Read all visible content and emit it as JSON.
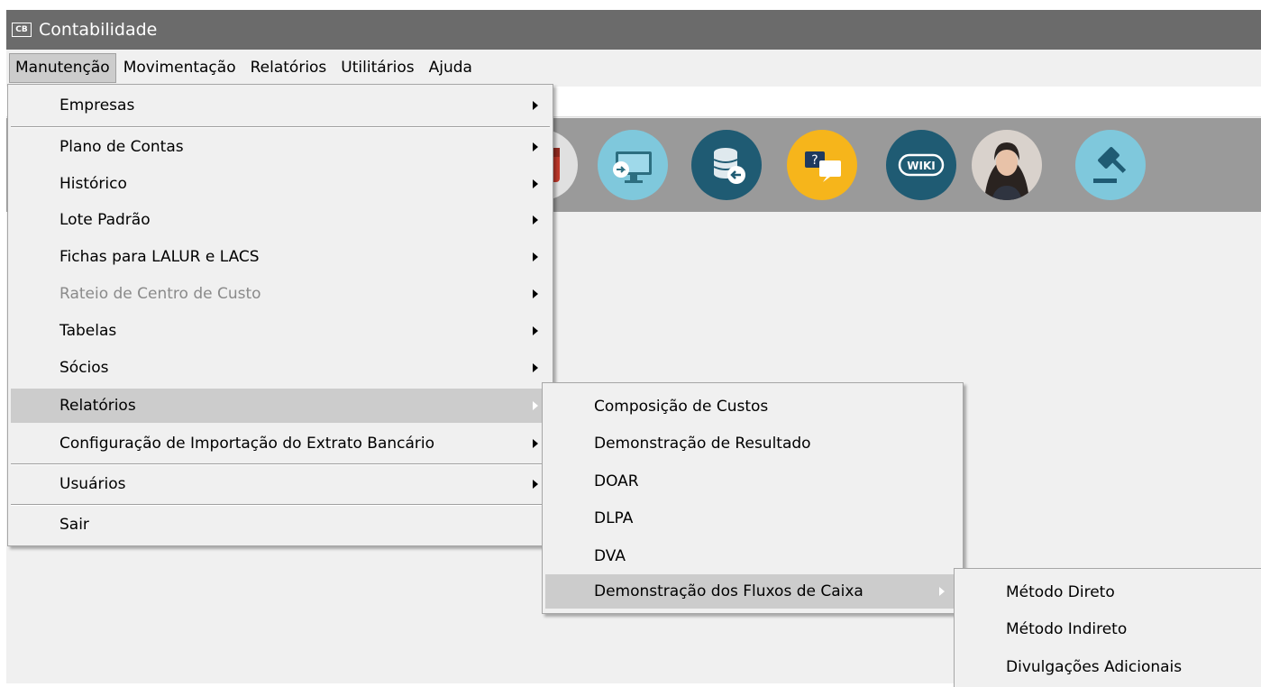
{
  "window": {
    "title": "Contabilidade",
    "icon_text": "CB"
  },
  "menubar": {
    "items": [
      "Manutenção",
      "Movimentação",
      "Relatórios",
      "Utilitários",
      "Ajuda"
    ]
  },
  "toolbar": {
    "icons": [
      "calendar-icon",
      "monitor-import-icon",
      "database-export-icon",
      "help-chat-icon",
      "wiki-icon",
      "assistant-avatar",
      "gavel-icon"
    ],
    "wiki_text": "WIKI",
    "help_text": "?"
  },
  "main_menu": {
    "items": [
      {
        "label": "Empresas",
        "submenu": true
      },
      {
        "label": "Plano de Contas",
        "submenu": true
      },
      {
        "label": "Histórico",
        "submenu": true
      },
      {
        "label": "Lote Padrão",
        "submenu": true
      },
      {
        "label": "Fichas para LALUR e LACS",
        "submenu": true
      },
      {
        "label": "Rateio de Centro de Custo",
        "submenu": true,
        "disabled": true
      },
      {
        "label": "Tabelas",
        "submenu": true
      },
      {
        "label": "Sócios",
        "submenu": true
      },
      {
        "label": "Relatórios",
        "submenu": true,
        "selected": true
      },
      {
        "label": "Configuração de Importação do Extrato Bancário",
        "submenu": true
      },
      {
        "label": "Usuários",
        "submenu": true
      },
      {
        "label": "Sair",
        "submenu": false
      }
    ]
  },
  "relatorios_menu": {
    "items": [
      {
        "label": "Composição de Custos"
      },
      {
        "label": "Demonstração de Resultado"
      },
      {
        "label": "DOAR"
      },
      {
        "label": "DLPA"
      },
      {
        "label": "DVA"
      },
      {
        "label": "Demonstração dos Fluxos de Caixa",
        "submenu": true,
        "selected": true
      }
    ]
  },
  "fluxos_menu": {
    "items": [
      {
        "label": "Método Direto"
      },
      {
        "label": "Método Indireto"
      },
      {
        "label": "Divulgações Adicionais"
      }
    ]
  },
  "colors": {
    "titlebar": "#6b6b6b",
    "toolbar": "#9a9a9a",
    "menu_bg": "#f0f0f0",
    "selected": "#cccccc"
  }
}
